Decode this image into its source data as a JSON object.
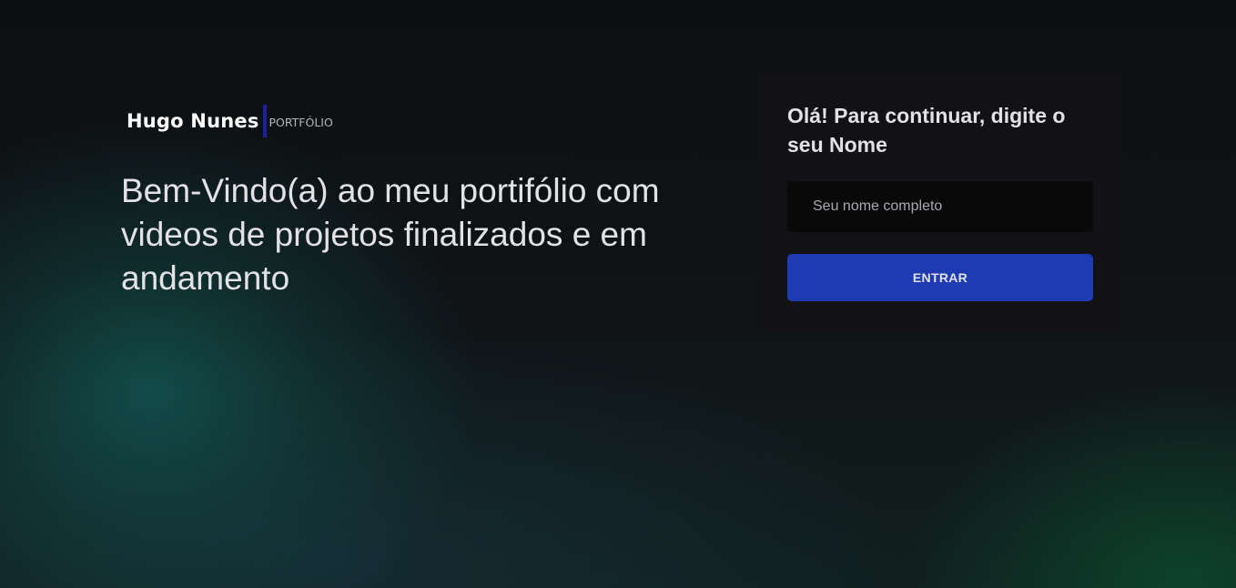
{
  "brand": {
    "name": "Hugo Nunes",
    "tag": "PORTFÓLIO"
  },
  "hero": {
    "headline": "Bem-Vindo(a) ao meu portifólio com videos de projetos finalizados e em andamento"
  },
  "login": {
    "title": "Olá! Para continuar, digite o seu Nome",
    "name_input": {
      "value": "",
      "placeholder": "Seu nome completo"
    },
    "submit_label": "ENTRAR"
  },
  "colors": {
    "background": "#0f1113",
    "card": "#121214",
    "input": "#09090a",
    "accent_button": "#1f3bb3",
    "brand_divider": "#1a1fa0",
    "text": "#e1e1e6",
    "teal_glow": "#125450",
    "green_glow": "#0c482e"
  }
}
